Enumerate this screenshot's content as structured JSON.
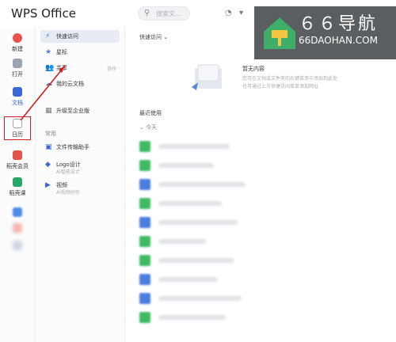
{
  "app": {
    "title": "WPS Office"
  },
  "search": {
    "placeholder": "搜索文..."
  },
  "rail": {
    "items": [
      {
        "label": "新建",
        "color": "#e5544b"
      },
      {
        "label": "打开",
        "color": "#9aa4b3"
      },
      {
        "label": "文档",
        "color": "#3a66d6"
      },
      {
        "label": "日历",
        "color": "#9aa4b3"
      },
      {
        "label": "稻壳会员",
        "color": "#e5544b"
      },
      {
        "label": "稻壳课",
        "color": "#2aa56a"
      }
    ]
  },
  "nav": {
    "items": [
      {
        "label": "快速访问",
        "icon": "⚡"
      },
      {
        "label": "星标",
        "icon": "★"
      },
      {
        "label": "共享",
        "icon": "👥",
        "extra": "协作"
      },
      {
        "label": "我的云文档",
        "icon": "☁"
      }
    ],
    "upgrade": "升级至企业版",
    "section": "常用",
    "apps": [
      {
        "label": "文件传输助手",
        "sub": ""
      },
      {
        "label": "Logo设计",
        "sub": "AI智能设计"
      },
      {
        "label": "视频",
        "sub": "AI视频创作"
      }
    ]
  },
  "main": {
    "quick_access": "快速访问",
    "empty_title": "暂无内容",
    "empty_line1": "您可在文档或文件夹的右键菜单中添加到此处",
    "empty_line2": "也可通过上方快捷访问菜单添加网址",
    "recent": "最近使用",
    "today": "今天"
  },
  "watermark": {
    "main": "６６导航",
    "sub": "66DAOHAN.COM"
  }
}
